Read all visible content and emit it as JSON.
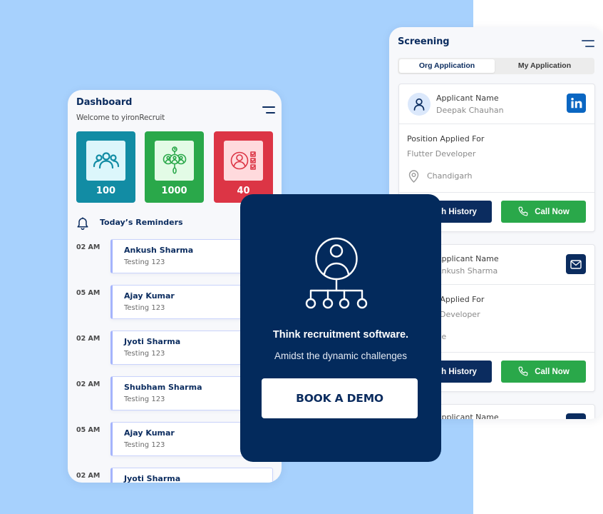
{
  "colors": {
    "background_accent": "#a7d1fd",
    "navy": "#0b2c5f",
    "promo_bg": "#032a5c",
    "teal": "#128ca4",
    "teal_light": "#dcf6fb",
    "green": "#2aa84a",
    "green_light": "#e3fbe6",
    "red": "#dc3545",
    "red_light": "#ffdadd",
    "reminder_accent": "#a5b4fc",
    "linkedin": "#0a66c2"
  },
  "dashboard": {
    "title": "Dashboard",
    "subtitle": "Welcome to yironRecruit",
    "menu_icon": "hamburger-icon",
    "stats": [
      {
        "value": "100",
        "icon": "users-group-icon"
      },
      {
        "value": "1000",
        "icon": "candidate-pipeline-icon"
      },
      {
        "value": "40",
        "icon": "applicant-checklist-icon"
      }
    ],
    "reminders_icon": "bell-icon",
    "reminders_title": "Today’s Reminders",
    "reminders": [
      {
        "time": "02 AM",
        "name": "Ankush Sharma",
        "note": "Testing 123"
      },
      {
        "time": "05 AM",
        "name": "Ajay Kumar",
        "note": "Testing 123"
      },
      {
        "time": "02 AM",
        "name": "Jyoti Sharma",
        "note": "Testing 123"
      },
      {
        "time": "02 AM",
        "name": "Shubham Sharma",
        "note": "Testing 123"
      },
      {
        "time": "05 AM",
        "name": "Ajay Kumar",
        "note": "Testing 123"
      },
      {
        "time": "02 AM",
        "name": "Jyoti Sharma",
        "note": ""
      }
    ]
  },
  "screening": {
    "title": "Screening",
    "menu_icon": "hamburger-icon",
    "tabs": [
      {
        "label": "Org Application",
        "active": true
      },
      {
        "label": "My Application",
        "active": false
      }
    ],
    "applicants": [
      {
        "name_label": "Applicant Name",
        "name": "Deepak Chauhan",
        "position_label": "Position Applied For",
        "position": "Flutter Developer",
        "location": "Chandigarh",
        "source_icon": "linkedin-icon",
        "watch_label": "Watch History",
        "call_label": "Call Now"
      },
      {
        "name_label": "Applicant Name",
        "name": "Ankush Sharma",
        "position_label": "Position Applied For",
        "position": "Android Developer",
        "location": "Pune",
        "source_icon": "mail-icon",
        "watch_label": "Watch History",
        "call_label": "Call Now"
      },
      {
        "name_label": "Applicant Name",
        "source_icon": "contact-source-icon"
      }
    ]
  },
  "promo": {
    "icon": "org-hierarchy-icon",
    "headline": "Think recruitment software.",
    "subtext": "Amidst the dynamic challenges",
    "cta_label": "BOOK A DEMO"
  }
}
